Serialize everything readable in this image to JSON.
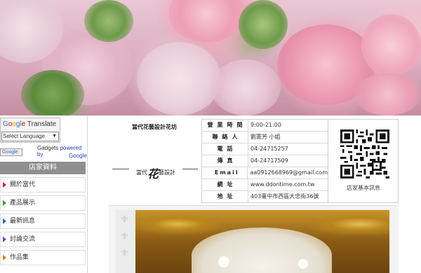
{
  "left": {
    "translate": {
      "title_google": [
        "G",
        "o",
        "o",
        "g",
        "l",
        "e"
      ],
      "title_text": "Translate",
      "select_value": "Select Language",
      "gadgets_text": "Gadgets",
      "powered_by": "powered by",
      "google": "Google",
      "badge": "Google"
    },
    "store_header": "店家資料",
    "menu": [
      {
        "label": "關於當代"
      },
      {
        "label": "產品展示"
      },
      {
        "label": "最新訊息"
      },
      {
        "label": "討論交流"
      },
      {
        "label": "作品集"
      }
    ]
  },
  "info": {
    "shop_name": "當代花藝設計花坊",
    "logo_left": "當代",
    "logo_mid": "花",
    "logo_right": "藝設計",
    "rows": [
      {
        "label": "營業時間",
        "value": "9:00-21:00"
      },
      {
        "label": "聯絡人",
        "value": "劉憲芳 小姐"
      },
      {
        "label": "電話",
        "value": "04-24715257"
      },
      {
        "label": "傳真",
        "value": "04-24717509"
      },
      {
        "label": "Email",
        "value": "aa0912668969@gmail.com"
      },
      {
        "label": "網址",
        "value": "www.ddontime.com.tw"
      },
      {
        "label": "地址",
        "value": "403臺中市西區大忠街36號"
      }
    ],
    "qr_label": "店家基本訊息"
  },
  "icons": {
    "menu_bullet": "triangle-right-icon",
    "qr": "qr-code-icon",
    "deco": "fleur-de-lis-icon"
  }
}
